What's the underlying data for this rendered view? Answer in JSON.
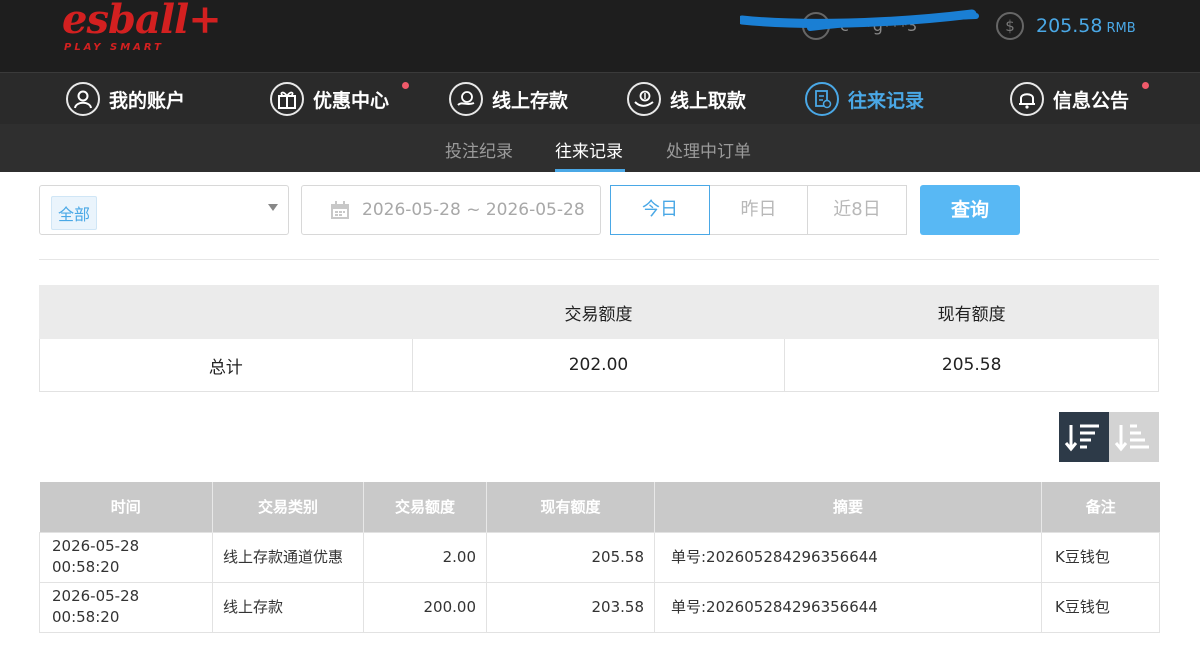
{
  "brand": {
    "logo_text": "esball+",
    "tagline": "PLAY SMART"
  },
  "user": {
    "name": "c***g***3"
  },
  "balance": {
    "amount": "205.58",
    "unit": "RMB"
  },
  "nav": [
    {
      "label": "我的账户",
      "icon": "user-icon"
    },
    {
      "label": "优惠中心",
      "icon": "gift-icon",
      "dot": true
    },
    {
      "label": "线上存款",
      "icon": "deposit-icon"
    },
    {
      "label": "线上取款",
      "icon": "withdraw-icon"
    },
    {
      "label": "往来记录",
      "icon": "records-icon",
      "active": true
    },
    {
      "label": "信息公告",
      "icon": "bell-icon",
      "dot": true
    }
  ],
  "subnav": [
    {
      "label": "投注纪录"
    },
    {
      "label": "往来记录",
      "active": true
    },
    {
      "label": "处理中订单"
    }
  ],
  "filters": {
    "type_selected": "全部",
    "date_range": "2026-05-28 ~ 2026-05-28",
    "quick_ranges": [
      "今日",
      "昨日",
      "近8日"
    ],
    "active_range": "今日",
    "query_label": "查询"
  },
  "summary": {
    "headers": [
      "",
      "交易额度",
      "现有额度"
    ],
    "row": [
      "总计",
      "202.00",
      "205.58"
    ]
  },
  "records": {
    "headers": [
      "时间",
      "交易类别",
      "交易额度",
      "现有额度",
      "摘要",
      "备注"
    ],
    "rows": [
      [
        "2026-05-28 00:58:20",
        "线上存款通道优惠",
        "2.00",
        "205.58",
        "单号:202605284296356644",
        "K豆钱包"
      ],
      [
        "2026-05-28 00:58:20",
        "线上存款",
        "200.00",
        "203.58",
        "单号:202605284296356644",
        "K豆钱包"
      ]
    ]
  },
  "colors": {
    "accent": "#4aa8e6",
    "brand_red": "#d32020",
    "notify_dot": "#f05a6a",
    "query_button": "#58b8f4"
  }
}
